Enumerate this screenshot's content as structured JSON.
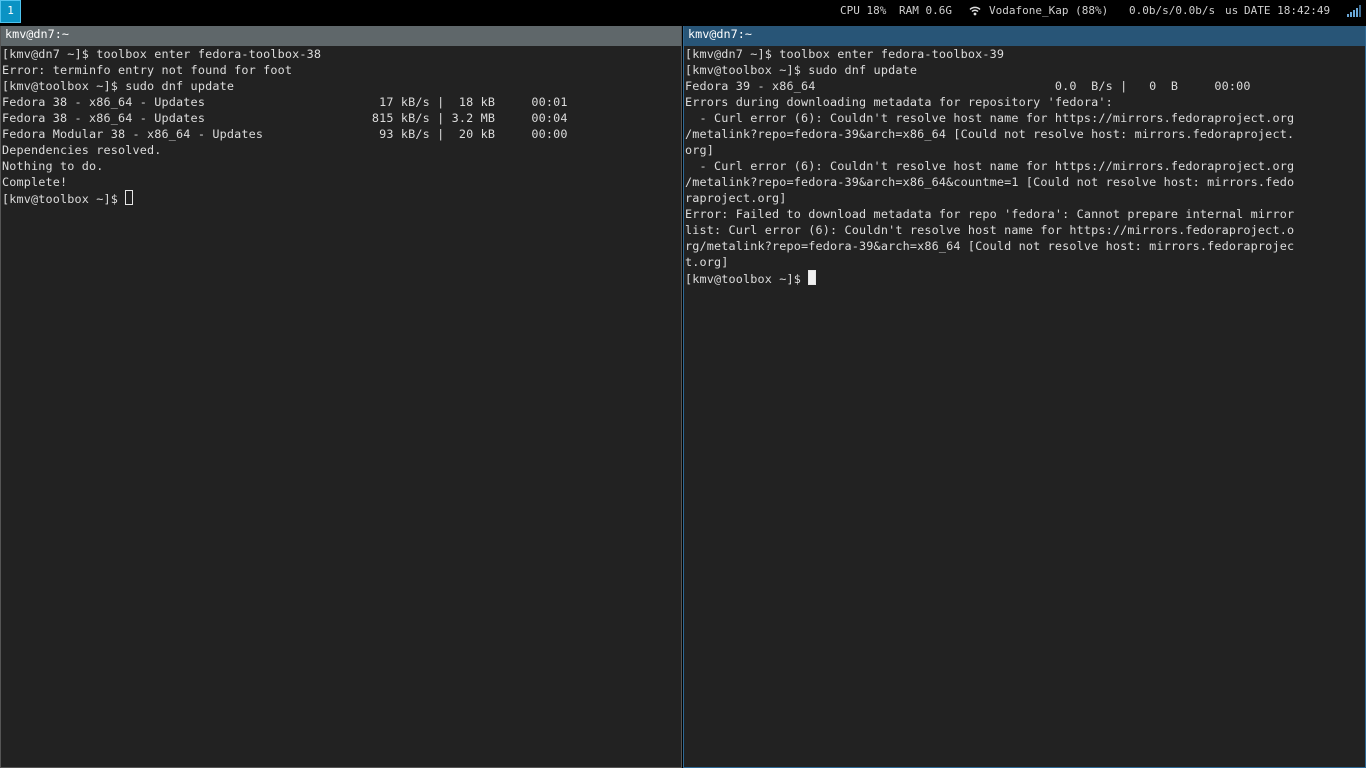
{
  "topbar": {
    "workspace": "1",
    "cpu": "CPU 18%",
    "ram": "RAM 0.6G",
    "wifi": "Vodafone_Kap (88%)",
    "net": "0.0b/s/0.0b/s",
    "locale": "us",
    "date": "DATE 18:42:49"
  },
  "left_pane": {
    "title": "kmv@dn7:~",
    "lines": [
      "[kmv@dn7 ~]$ toolbox enter fedora-toolbox-38",
      "Error: terminfo entry not found for foot",
      "[kmv@toolbox ~]$ sudo dnf update",
      "Fedora 38 - x86_64 - Updates                        17 kB/s |  18 kB     00:01",
      "Fedora 38 - x86_64 - Updates                       815 kB/s | 3.2 MB     00:04",
      "Fedora Modular 38 - x86_64 - Updates                93 kB/s |  20 kB     00:00",
      "Dependencies resolved.",
      "Nothing to do.",
      "Complete!"
    ],
    "prompt": "[kmv@toolbox ~]$ "
  },
  "right_pane": {
    "title": "kmv@dn7:~",
    "lines": [
      "[kmv@dn7 ~]$ toolbox enter fedora-toolbox-39",
      "[kmv@toolbox ~]$ sudo dnf update",
      "Fedora 39 - x86_64                                 0.0  B/s |   0  B     00:00",
      "Errors during downloading metadata for repository 'fedora':",
      "  - Curl error (6): Couldn't resolve host name for https://mirrors.fedoraproject.org",
      "/metalink?repo=fedora-39&arch=x86_64 [Could not resolve host: mirrors.fedoraproject.",
      "org]",
      "  - Curl error (6): Couldn't resolve host name for https://mirrors.fedoraproject.org",
      "/metalink?repo=fedora-39&arch=x86_64&countme=1 [Could not resolve host: mirrors.fedo",
      "raproject.org]",
      "Error: Failed to download metadata for repo 'fedora': Cannot prepare internal mirror",
      "list: Curl error (6): Couldn't resolve host name for https://mirrors.fedoraproject.o",
      "rg/metalink?repo=fedora-39&arch=x86_64 [Could not resolve host: mirrors.fedoraprojec",
      "t.org]"
    ],
    "prompt": "[kmv@toolbox ~]$ "
  }
}
